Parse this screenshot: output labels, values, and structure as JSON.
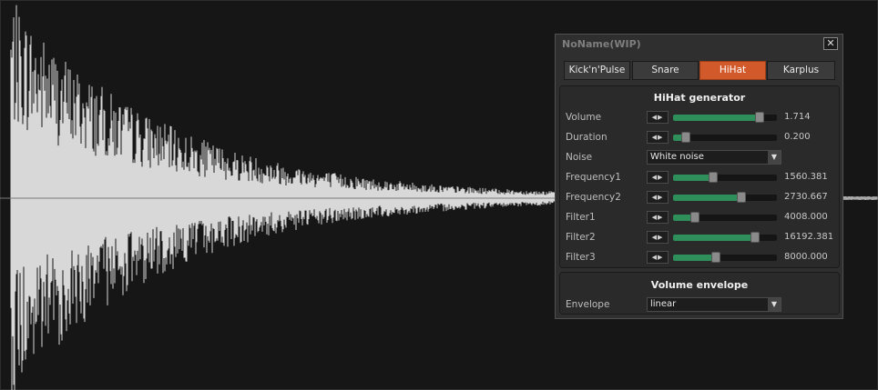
{
  "window": {
    "title": "NoName(WIP)",
    "close_icon": "close-icon"
  },
  "tabs": [
    {
      "label": "Kick'n'Pulse",
      "active": false
    },
    {
      "label": "Snare",
      "active": false
    },
    {
      "label": "HiHat",
      "active": true
    },
    {
      "label": "Karplus",
      "active": false
    }
  ],
  "generator": {
    "title": "HiHat generator",
    "params": [
      {
        "label": "Volume",
        "value": "1.714",
        "level": 0.83
      },
      {
        "label": "Duration",
        "value": "0.200",
        "level": 0.12
      },
      {
        "label": "Frequency1",
        "value": "1560.381",
        "level": 0.39
      },
      {
        "label": "Frequency2",
        "value": "2730.667",
        "level": 0.66
      },
      {
        "label": "Filter1",
        "value": "4008.000",
        "level": 0.21
      },
      {
        "label": "Filter2",
        "value": "16192.381",
        "level": 0.79
      },
      {
        "label": "Filter3",
        "value": "8000.000",
        "level": 0.41
      }
    ],
    "noise": {
      "label": "Noise",
      "value": "White noise"
    }
  },
  "envelope": {
    "title": "Volume envelope",
    "label": "Envelope",
    "value": "linear"
  },
  "colors": {
    "accent": "#d2592a",
    "slider": "#2f8f5a",
    "waveform": "#d8d8d8",
    "background": "#161616"
  }
}
